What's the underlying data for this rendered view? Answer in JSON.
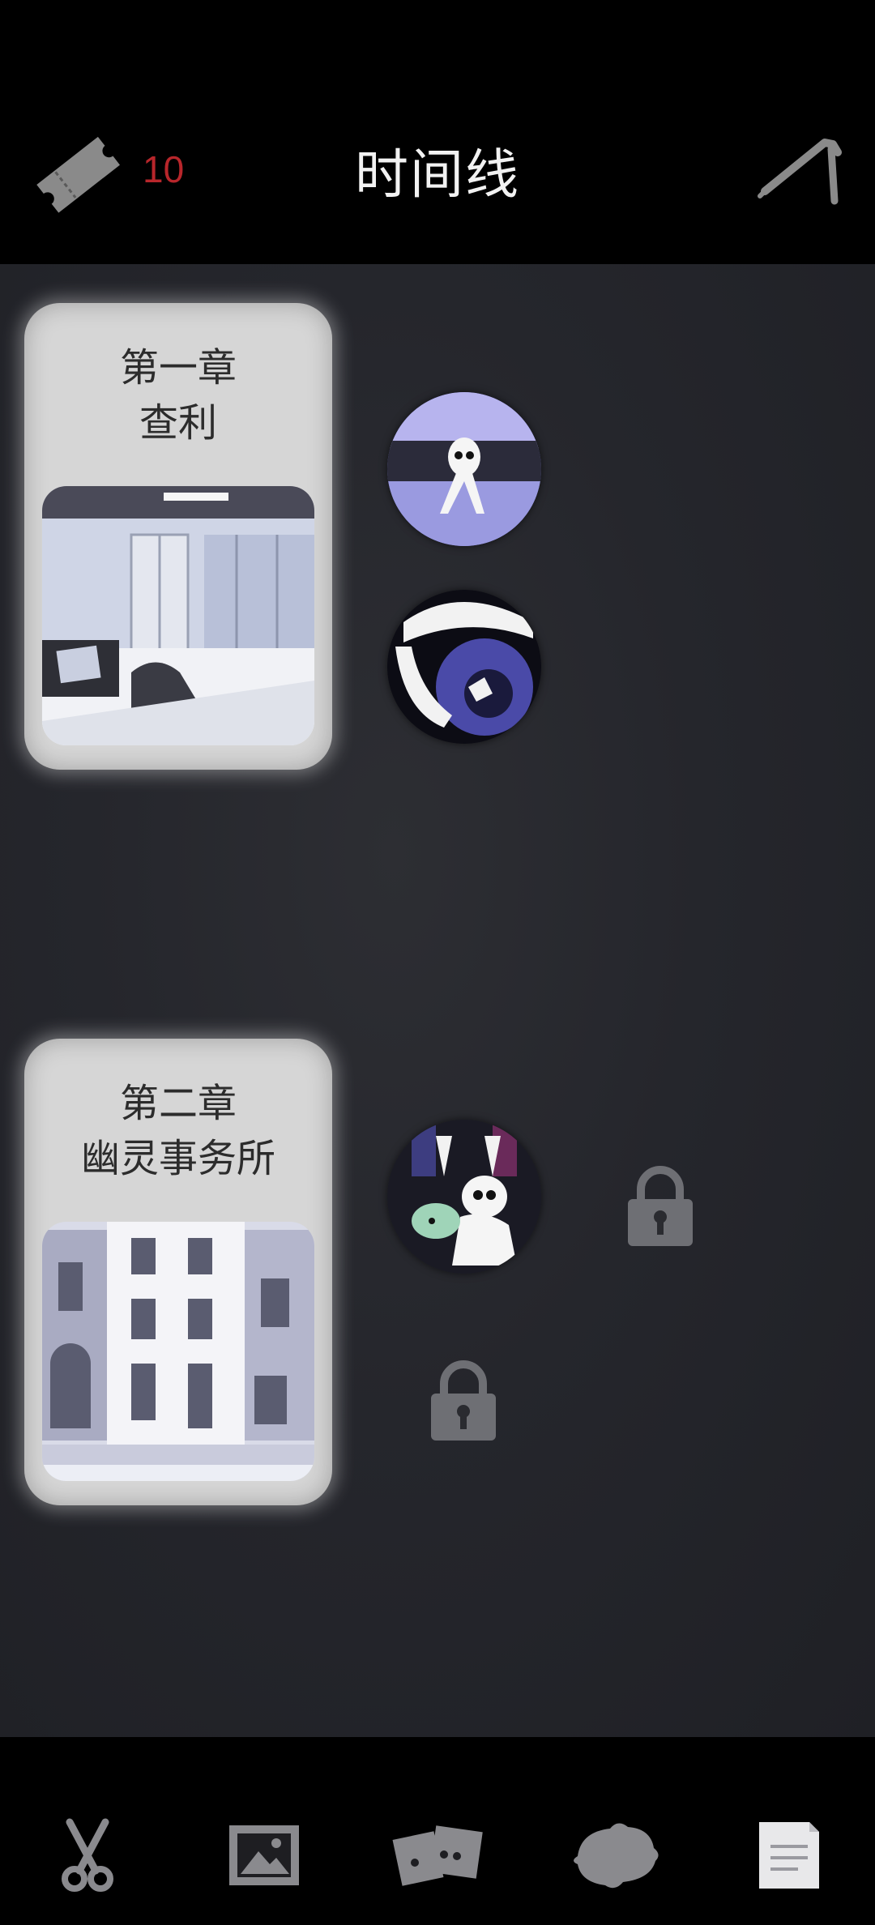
{
  "header": {
    "title": "时间线",
    "ticket_count": "10",
    "ticket_icon": "ticket-icon",
    "tool_icon": "crowbar-icon"
  },
  "chapters": [
    {
      "title_line1": "第一章",
      "title_line2": "查利",
      "art": "office-interior-illustration",
      "scenes": [
        {
          "state": "unlocked",
          "art": "creature-sitting-on-floor"
        },
        {
          "state": "unlocked",
          "art": "open-mouth-teeth"
        }
      ]
    },
    {
      "title_line1": "第二章",
      "title_line2": "幽灵事务所",
      "art": "townhouse-facade-illustration",
      "scenes": [
        {
          "state": "unlocked",
          "art": "characters-huddled"
        },
        {
          "state": "locked",
          "icon": "lock-icon"
        },
        {
          "state": "locked",
          "icon": "lock-icon"
        }
      ]
    }
  ],
  "bottom_nav": [
    {
      "icon": "scissors-icon",
      "active": false
    },
    {
      "icon": "gallery-icon",
      "active": false
    },
    {
      "icon": "cards-icon",
      "active": false
    },
    {
      "icon": "creature-icon",
      "active": false
    },
    {
      "icon": "notes-icon",
      "active": true
    }
  ],
  "colors": {
    "background": "#000000",
    "timeline_bg": "#25262c",
    "card": "#d6d6d6",
    "ticket_count": "#b8262b",
    "title": "#f2f2f2"
  }
}
